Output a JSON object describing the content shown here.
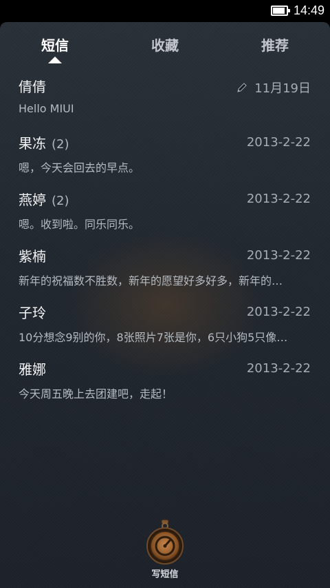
{
  "status": {
    "time": "14:49",
    "battery_level": 0.9
  },
  "tabs": [
    {
      "label": "短信",
      "active": true
    },
    {
      "label": "收藏",
      "active": false
    },
    {
      "label": "推荐",
      "active": false
    }
  ],
  "messages": [
    {
      "name": "倩倩",
      "count": "",
      "date": "11月19日",
      "preview": "Hello MIUI",
      "draft": true
    },
    {
      "name": "果冻",
      "count": "(2)",
      "date": "2013-2-22",
      "preview": "嗯，今天会回去的早点。",
      "draft": false
    },
    {
      "name": "燕婷",
      "count": "(2)",
      "date": "2013-2-22",
      "preview": "嗯。收到啦。同乐同乐。",
      "draft": false
    },
    {
      "name": "紫楠",
      "count": "",
      "date": "2013-2-22",
      "preview": "新年的祝福数不胜数，新年的愿望好多好多，新年的…",
      "draft": false
    },
    {
      "name": "子玲",
      "count": "",
      "date": "2013-2-22",
      "preview": "10分想念9别的你，8张照片7张是你，6只小狗5只像…",
      "draft": false
    },
    {
      "name": "雅娜",
      "count": "",
      "date": "2013-2-22",
      "preview": "今天周五晚上去团建吧，走起！",
      "draft": false
    }
  ],
  "compose": {
    "label": "写短信",
    "icon": "compose-pocket-watch-icon"
  },
  "colors": {
    "accent": "#b5733a",
    "background": "#23292f"
  }
}
